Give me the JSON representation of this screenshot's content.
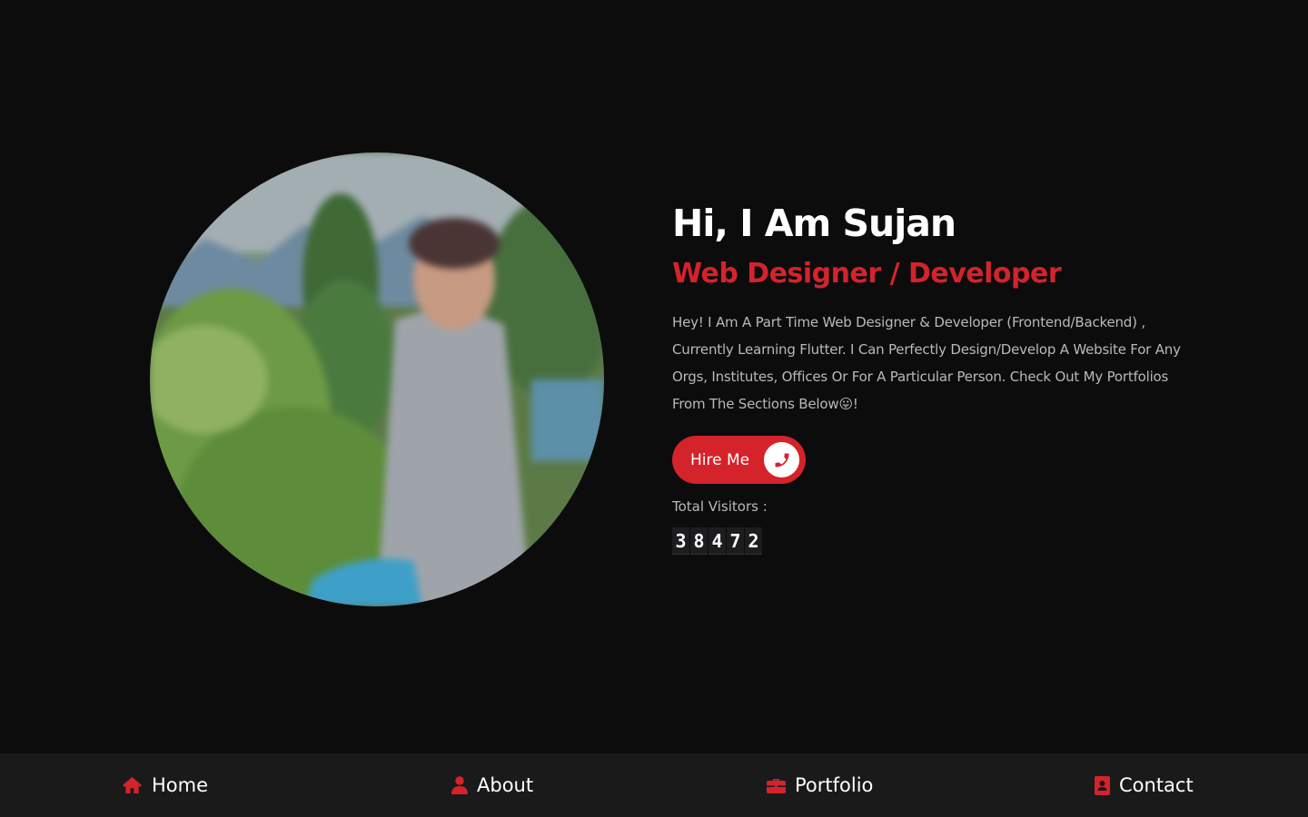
{
  "hero": {
    "greeting": "Hi, I Am Sujan",
    "role": "Web Designer / Developer",
    "bio": "Hey! I Am A Part Time Web Designer & Developer (Frontend/Backend) , Currently Learning Flutter. I Can Perfectly Design/Develop A Website For Any Orgs, Institutes, Offices Or For A Particular Person. Check Out My Portfolios From The Sections Below😛!",
    "hire_button": "Hire Me",
    "hire_icon": "phone-icon"
  },
  "visitors": {
    "label": "Total Visitors :",
    "digits": [
      "3",
      "8",
      "4",
      "7",
      "2"
    ]
  },
  "nav": {
    "items": [
      {
        "label": "Home",
        "icon": "home-icon"
      },
      {
        "label": "About",
        "icon": "user-icon"
      },
      {
        "label": "Portfolio",
        "icon": "briefcase-icon"
      },
      {
        "label": "Contact",
        "icon": "contact-book-icon"
      }
    ]
  },
  "colors": {
    "accent": "#d4232b",
    "background": "#0c0c0d",
    "nav_background": "#1a1a1b"
  }
}
